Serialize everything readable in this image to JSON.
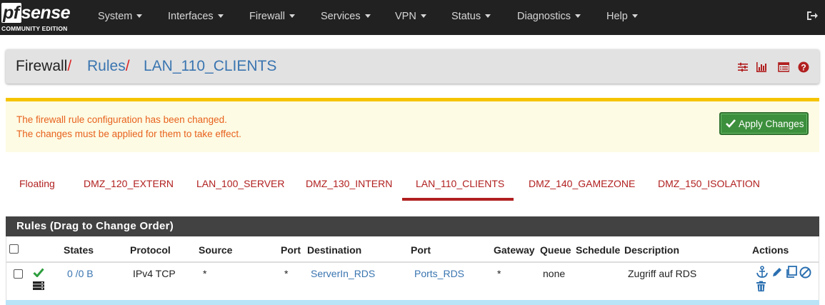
{
  "brand": {
    "name_pf": "pf",
    "name_sense": "sense",
    "edition": "COMMUNITY EDITION"
  },
  "nav": {
    "items": [
      "System",
      "Interfaces",
      "Firewall",
      "Services",
      "VPN",
      "Status",
      "Diagnostics",
      "Help"
    ]
  },
  "breadcrumb": {
    "part1": "Firewall",
    "part2": "Rules",
    "part3": "LAN_110_CLIENTS",
    "separator": "/"
  },
  "alert": {
    "line1": "The firewall rule configuration has been changed.",
    "line2": "The changes must be applied for them to take effect.",
    "apply_label": "Apply Changes"
  },
  "tabs": [
    "Floating",
    "DMZ_120_EXTERN",
    "LAN_100_SERVER",
    "DMZ_130_INTERN",
    "LAN_110_CLIENTS",
    "DMZ_140_GAMEZONE",
    "DMZ_150_ISOLATION"
  ],
  "active_tab": "LAN_110_CLIENTS",
  "panel": {
    "title": "Rules (Drag to Change Order)"
  },
  "table": {
    "headers": [
      "States",
      "Protocol",
      "Source",
      "Port",
      "Destination",
      "Port",
      "Gateway",
      "Queue",
      "Schedule",
      "Description",
      "Actions"
    ],
    "rows": [
      {
        "states": "0 /0 B",
        "protocol": "IPv4 TCP",
        "source": "*",
        "source_port": "*",
        "destination": "ServerIn_RDS",
        "destination_port": "Ports_RDS",
        "gateway": "*",
        "queue": "none",
        "schedule": "",
        "description": "Zugriff auf RDS"
      }
    ]
  },
  "colors": {
    "navbar": "#212121",
    "accent_red": "#b11f1f",
    "link_blue": "#3a75b0",
    "alert_text": "#e8621e",
    "apply_green": "#3c8f3c"
  },
  "icons": [
    "logout-icon",
    "filter-icon",
    "chart-icon",
    "table-icon",
    "help-icon",
    "check-icon",
    "anchor-icon",
    "pencil-icon",
    "copy-icon",
    "ban-icon",
    "trash-icon",
    "server-icon"
  ]
}
